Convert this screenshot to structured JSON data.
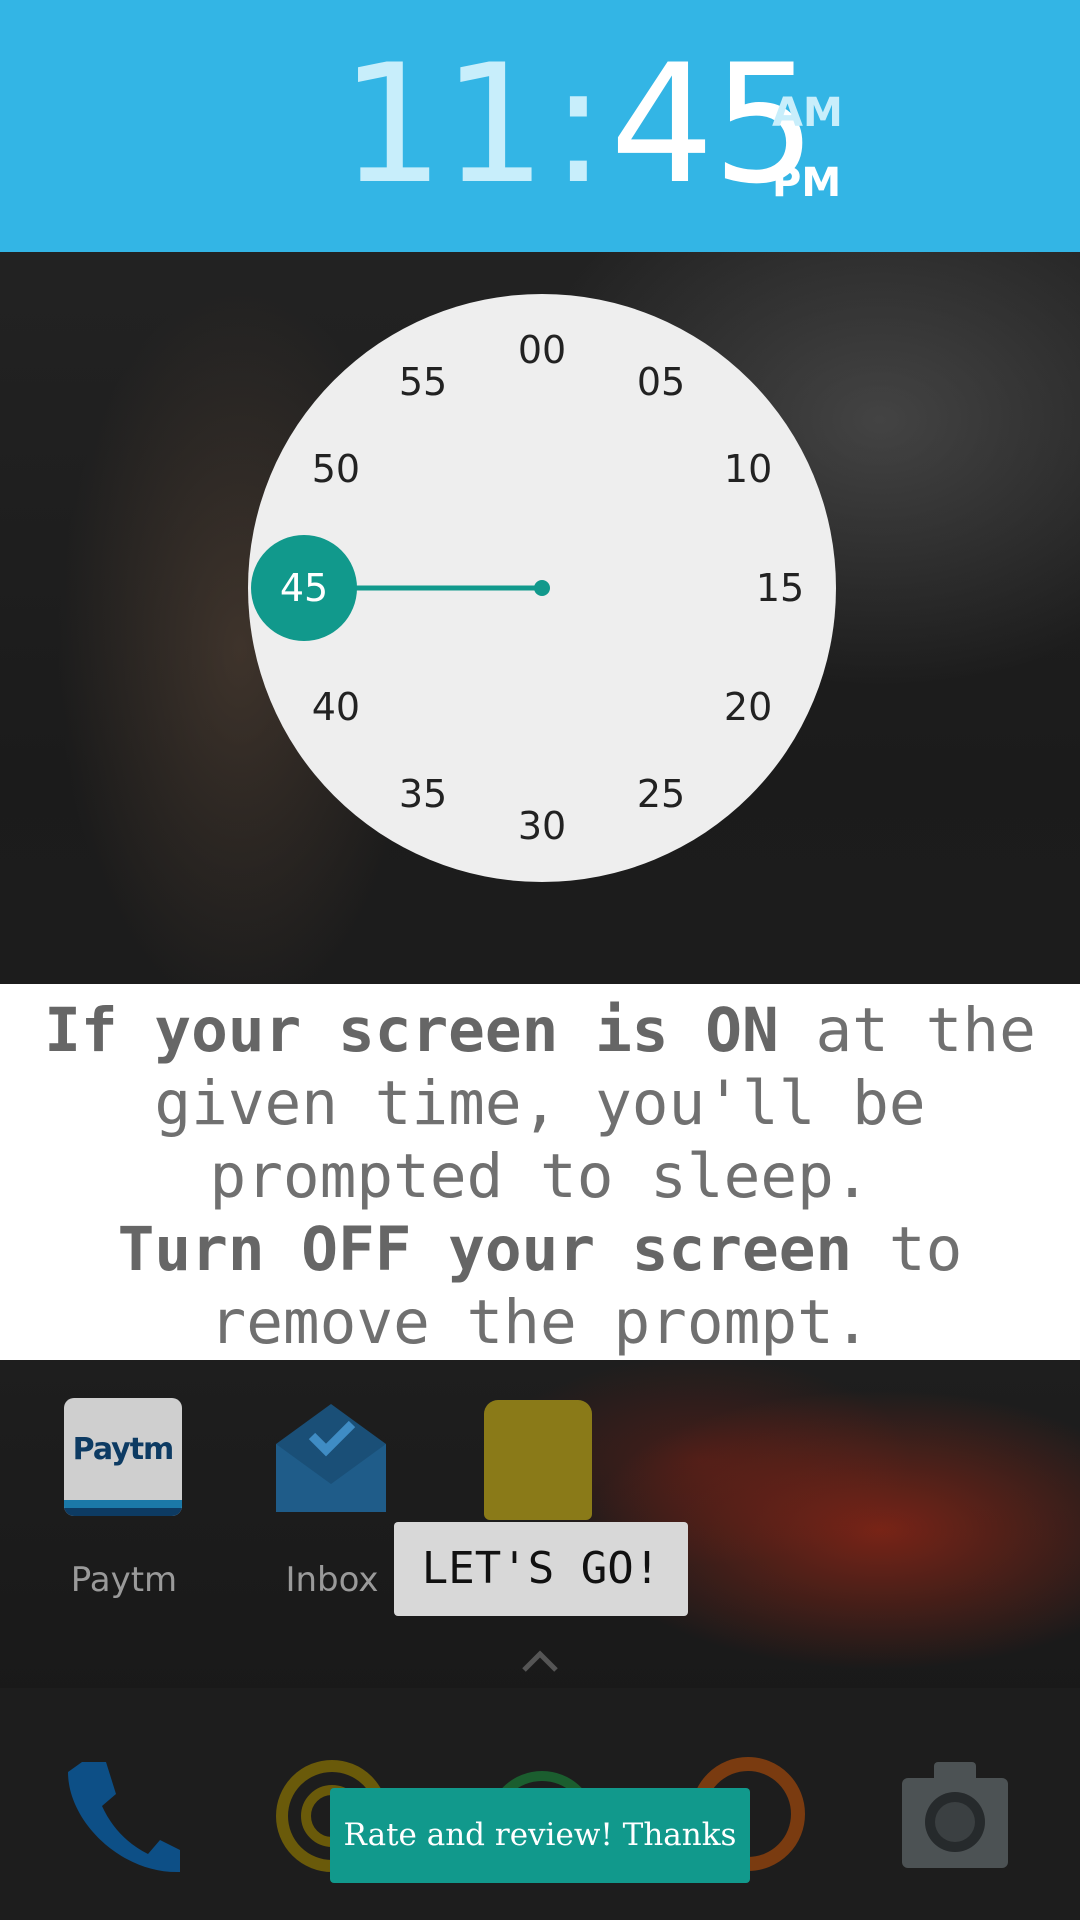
{
  "time_header": {
    "hours": "11",
    "colon": ":",
    "minutes": "45",
    "am_label": "AM",
    "pm_label": "PM",
    "selected_period": "PM",
    "background_color": "#33b5e5"
  },
  "dial": {
    "numbers": [
      "00",
      "05",
      "10",
      "15",
      "20",
      "25",
      "30",
      "35",
      "40",
      "45",
      "50",
      "55"
    ],
    "selected": "45",
    "accent_color": "#11998c"
  },
  "message": {
    "line1_bold": "If your screen is ON",
    "line1_rest": " at the given time, you'll be prompted to sleep.",
    "line2_bold": "Turn OFF your screen",
    "line2_rest": " to remove the prompt."
  },
  "apps": {
    "paytm": {
      "icon_text": "Paytm",
      "label": "Paytm",
      "icon": "paytm-icon"
    },
    "inbox": {
      "label": "Inbox",
      "icon": "inbox-envelope-icon"
    },
    "lego": {
      "icon": "lego-character-icon"
    }
  },
  "dock": {
    "icons": [
      "phone-icon",
      "app-icon",
      "app-icon",
      "browser-icon",
      "camera-icon"
    ]
  },
  "buttons": {
    "lets_go": "LET'S GO!",
    "rate_review": "Rate and review! Thanks"
  }
}
